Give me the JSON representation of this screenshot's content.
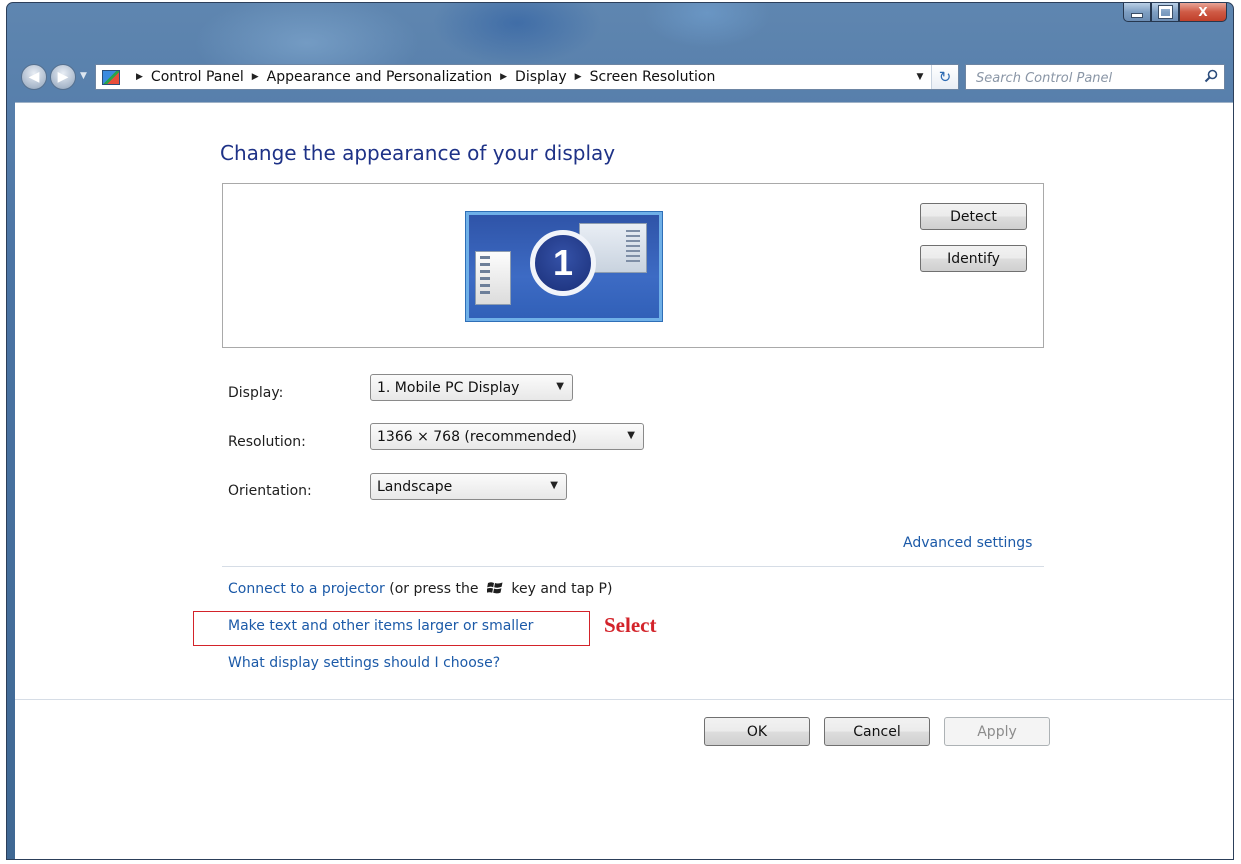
{
  "window": {
    "caption_buttons": {
      "minimize": "minimize",
      "maximize": "maximize",
      "close": "X"
    }
  },
  "navigation": {
    "breadcrumbs": [
      "Control Panel",
      "Appearance and Personalization",
      "Display",
      "Screen Resolution"
    ],
    "search_placeholder": "Search Control Panel"
  },
  "page": {
    "title": "Change the appearance of your display",
    "monitor_number": "1",
    "detect_label": "Detect",
    "identify_label": "Identify"
  },
  "settings": {
    "display_label": "Display:",
    "display_value": "1. Mobile PC Display",
    "resolution_label": "Resolution:",
    "resolution_value": "1366 × 768 (recommended)",
    "orientation_label": "Orientation:",
    "orientation_value": "Landscape"
  },
  "links": {
    "advanced": "Advanced settings",
    "projector": "Connect to a projector",
    "projector_suffix_before": "(or press the",
    "projector_suffix_after": "key and tap P)",
    "text_size": "Make text and other items larger or smaller",
    "help": "What display settings should I choose?"
  },
  "annotation": {
    "select_label": "Select",
    "color": "#d3232a"
  },
  "footer": {
    "ok": "OK",
    "cancel": "Cancel",
    "apply": "Apply"
  },
  "colors": {
    "title": "#1e3287",
    "link": "#1c5aa8",
    "frame": "#4b74a4"
  }
}
